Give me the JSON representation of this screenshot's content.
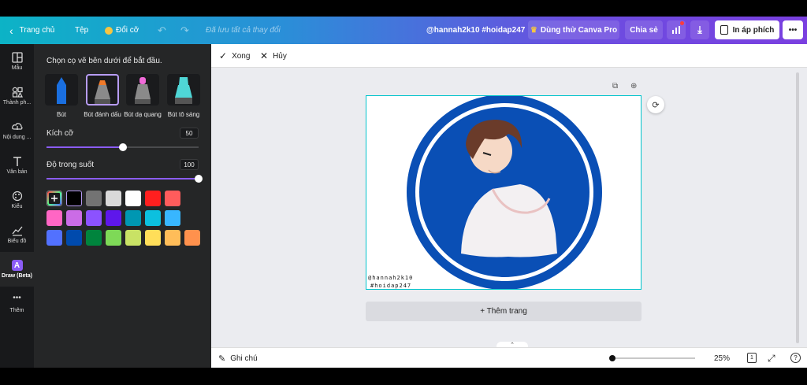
{
  "header": {
    "home": "Trang chủ",
    "file": "Tệp",
    "resize": "Đổi cỡ",
    "save_status": "Đã lưu tất cả thay đổi",
    "doc_title": "@hannah2k10 #hoidap247",
    "try_pro": "Dùng thử Canva Pro",
    "share": "Chia sẻ",
    "print": "In áp phích",
    "more": "•••"
  },
  "rail": {
    "items": [
      {
        "label": "Mẫu",
        "icon": "template-icon"
      },
      {
        "label": "Thành ph...",
        "icon": "elements-icon"
      },
      {
        "label": "Nội dung ...",
        "icon": "upload-icon"
      },
      {
        "label": "Văn bản",
        "icon": "text-icon"
      },
      {
        "label": "Kiểu",
        "icon": "palette-icon"
      },
      {
        "label": "Biểu đồ",
        "icon": "chart-icon"
      },
      {
        "label": "Draw (Beta)",
        "icon": "draw-icon"
      },
      {
        "label": "Thêm",
        "icon": "more-icon"
      }
    ]
  },
  "panel": {
    "prompt": "Chọn cọ vẽ bên dưới để bắt đầu.",
    "brushes": [
      {
        "label": "Bút",
        "color": "#1a6fe0"
      },
      {
        "label": "Bút đánh dấu",
        "color": "#f07a2a"
      },
      {
        "label": "Bút dạ quang",
        "color": "#f06ad8"
      },
      {
        "label": "Bút tô sáng",
        "color": "#4fd6d6"
      }
    ],
    "size_label": "Kích cỡ",
    "size_value": "50",
    "size_level": 0.5,
    "opacity_label": "Độ trong suốt",
    "opacity_value": "100",
    "opacity_level": 1.0,
    "swatches": [
      "#000000",
      "#737373",
      "#d9d9d9",
      "#ffffff",
      "#ff1f1f",
      "#ff5c5c",
      "#ff66c4",
      "#cb6ce6",
      "#8c52ff",
      "#5e17eb",
      "#0097b2",
      "#0cc0df",
      "#5ce1e6",
      "#38b6ff",
      "#5271ff",
      "#004aad",
      "#00843d",
      "#7ed957",
      "#c9e265",
      "#ffde59",
      "#ffbd59",
      "#ff914d"
    ]
  },
  "toolbar": {
    "done": "Xong",
    "cancel": "Hủy"
  },
  "canvas": {
    "watermark_line1": "@hannah2k10",
    "watermark_line2": "#hoidap247",
    "add_page": "+ Thêm trang"
  },
  "bottom": {
    "notes": "Ghi chú",
    "zoom": "25%",
    "zoom_level": 0.0,
    "page_count": "1",
    "help": "?"
  }
}
